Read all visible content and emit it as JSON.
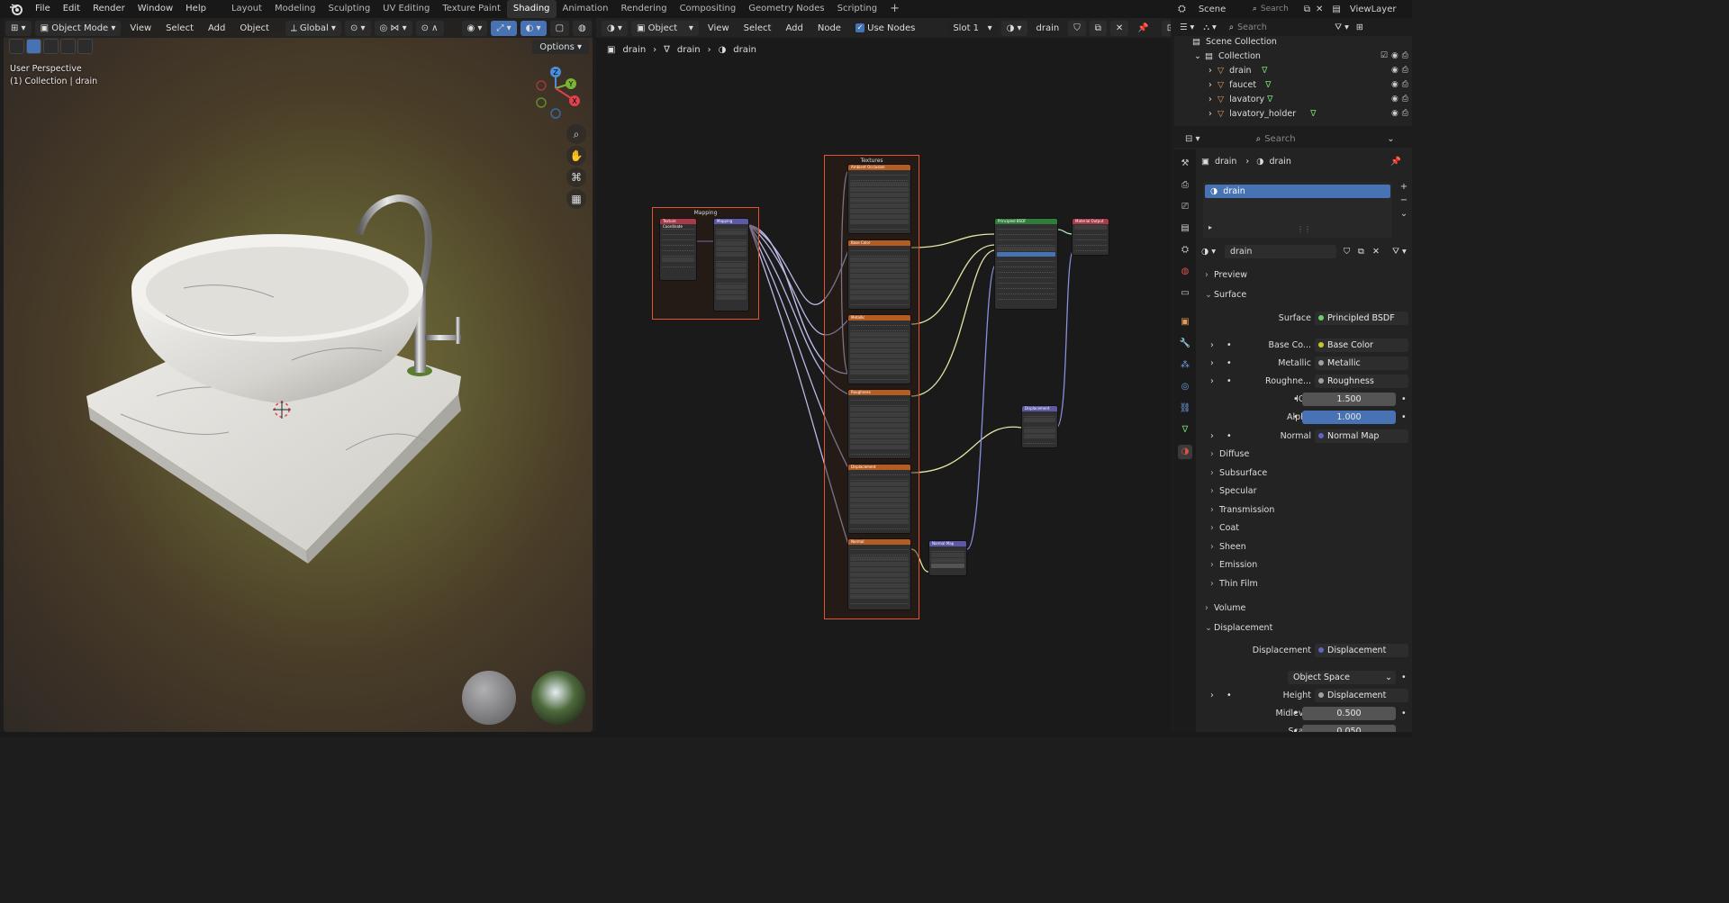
{
  "topbar": {
    "menus": [
      "File",
      "Edit",
      "Render",
      "Window",
      "Help"
    ],
    "tabs": [
      "Layout",
      "Modeling",
      "Sculpting",
      "UV Editing",
      "Texture Paint",
      "Shading",
      "Animation",
      "Rendering",
      "Compositing",
      "Geometry Nodes",
      "Scripting"
    ],
    "active_tab": "Shading",
    "scene": "Scene",
    "search_placeholder": "Search",
    "view_layer": "ViewLayer"
  },
  "viewport": {
    "mode": "Object Mode",
    "menus": [
      "View",
      "Select",
      "Add",
      "Object"
    ],
    "orientation": "Global",
    "options": "Options",
    "title_line1": "User Perspective",
    "title_line2": "(1) Collection | drain",
    "gizmo": {
      "z": "Z",
      "y": "Y",
      "x": "X"
    }
  },
  "node_editor": {
    "type": "Object",
    "menus": [
      "View",
      "Select",
      "Add",
      "Node"
    ],
    "use_nodes": "Use Nodes",
    "slot": "Slot 1",
    "material": "drain",
    "breadcrumb": [
      "drain",
      "drain",
      "drain"
    ],
    "frames": {
      "mapping": "Mapping",
      "textures": "Textures"
    },
    "nodes": {
      "tex_coord": "Texture Coordinate",
      "mapping": "Mapping",
      "ao": "Ambient Occlusion",
      "base_color": "Base Color",
      "metallic": "Metallic",
      "roughness": "Roughness",
      "displacement": "Displacement",
      "normal": "Normal",
      "bsdf": "Principled BSDF",
      "output": "Material Output",
      "disp_node": "Displacement",
      "normal_map": "Normal Map"
    }
  },
  "outliner": {
    "root": "Scene Collection",
    "collection": "Collection",
    "items": [
      "drain",
      "faucet",
      "lavatory",
      "lavatory_holder"
    ],
    "search_placeholder": "Search"
  },
  "properties": {
    "search_placeholder": "Search",
    "breadcrumb": [
      "drain",
      "drain"
    ],
    "slot_item": "drain",
    "material_name": "drain",
    "sections": {
      "preview": "Preview",
      "surface": "Surface",
      "volume": "Volume",
      "displacement": "Displacement"
    },
    "surface": {
      "surface_label": "Surface",
      "surface_value": "Principled BSDF",
      "base_color_label": "Base Co...",
      "base_color_value": "Base Color",
      "metallic_label": "Metallic",
      "metallic_value": "Metallic",
      "roughness_label": "Roughne...",
      "roughness_value": "Roughness",
      "ior_label": "IOR",
      "ior_value": "1.500",
      "alpha_label": "Alpha",
      "alpha_value": "1.000",
      "normal_label": "Normal",
      "normal_value": "Normal Map"
    },
    "subsections": [
      "Diffuse",
      "Subsurface",
      "Specular",
      "Transmission",
      "Coat",
      "Sheen",
      "Emission",
      "Thin Film"
    ],
    "displacement": {
      "disp_label": "Displacement",
      "disp_value": "Displacement",
      "space": "Object Space",
      "height_label": "Height",
      "height_value": "Displacement",
      "midlevel_label": "Midlevel",
      "midlevel_value": "0.500",
      "scale_label": "Scale",
      "scale_value": "0.050"
    }
  }
}
